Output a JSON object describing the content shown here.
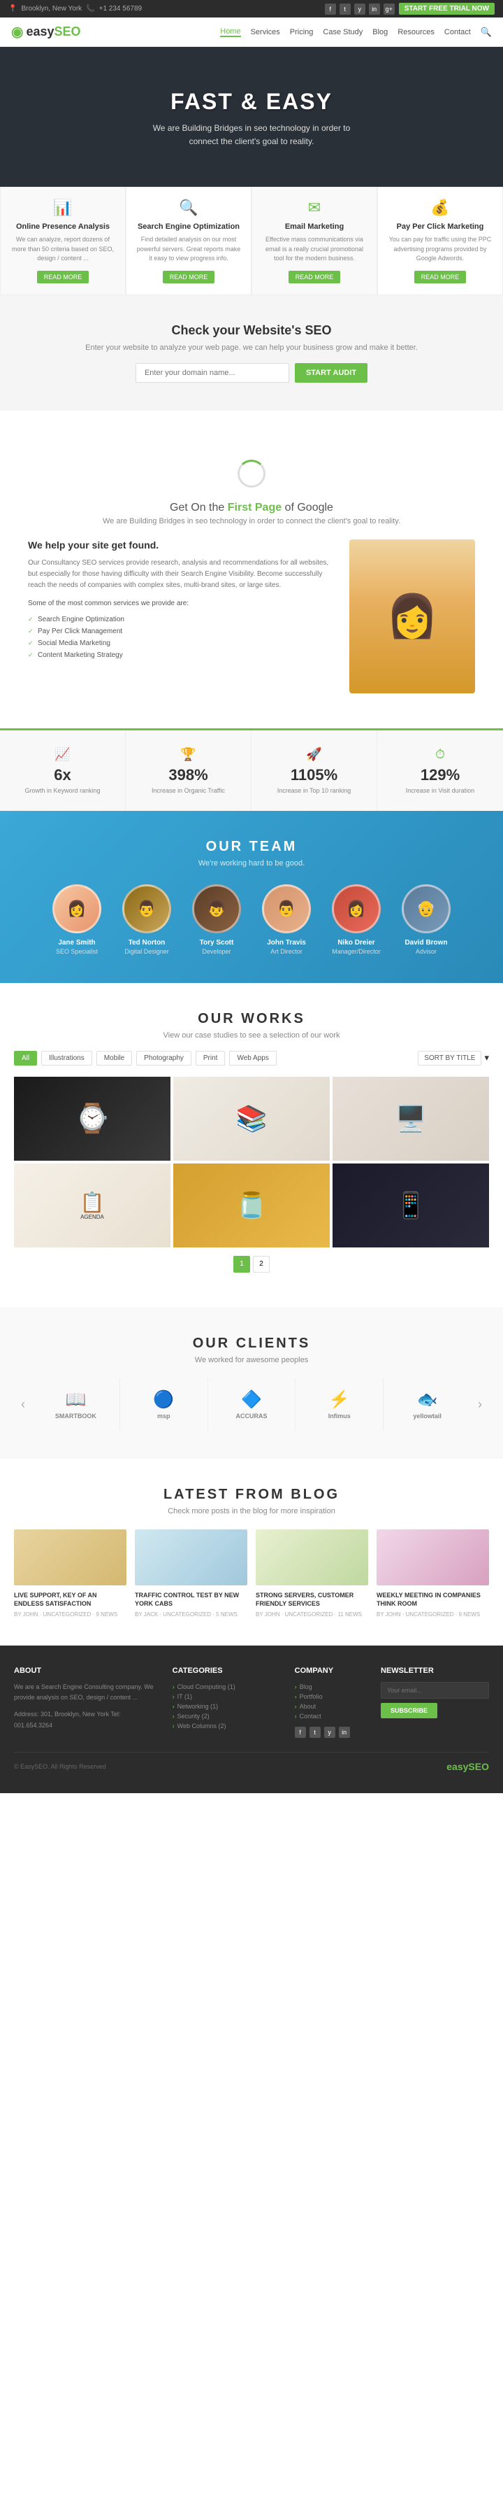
{
  "topbar": {
    "location": "Brooklyn, New York",
    "phone": "+1 234 56789",
    "social": [
      "f",
      "t",
      "y",
      "in",
      "g+"
    ],
    "cta": "START FREE TRIAL NOW"
  },
  "navbar": {
    "logo": "easy",
    "logo_suffix": "SEO",
    "links": [
      "Home",
      "Services",
      "Pricing",
      "Case Study",
      "Blog",
      "Resources",
      "Contact"
    ],
    "active": "Home"
  },
  "hero": {
    "title": "FAST & EASY",
    "description": "We are Building Bridges in seo technology in order to connect the client's goal to reality."
  },
  "services": [
    {
      "icon": "📊",
      "title": "Online Presence Analysis",
      "desc": "We can analyze, report dozens of more than 50 criteria based on SEO, design / content ...",
      "btn": "READ MORE"
    },
    {
      "icon": "🔍",
      "title": "Search Engine Optimization",
      "desc": "Find detailed analysis on our most powerful servers. Great reports make it easy to view progress info.",
      "btn": "READ MORE"
    },
    {
      "icon": "✉",
      "title": "Email Marketing",
      "desc": "Effective mass communications via email is a really crucial promotional tool for the modern business.",
      "btn": "READ MORE"
    },
    {
      "icon": "💰",
      "title": "Pay Per Click Marketing",
      "desc": "You can pay for traffic using the PPC advertising programs provided by Google Adwords.",
      "btn": "READ MORE"
    }
  ],
  "seo_check": {
    "title": "Check your Website's SEO",
    "desc": "Enter your website to analyze your web page. we can help your business grow and make it better.",
    "placeholder": "Enter your domain name...",
    "btn": "START AUDIT"
  },
  "google_section": {
    "pre_title": "Get On the",
    "title_bold": "First Page",
    "title_rest": "of Google",
    "sub": "We are Building Bridges in seo technology in order to connect the client's goal to reality.",
    "help_title": "We help your site get found.",
    "help_desc": "Our Consultancy SEO services provide research, analysis and recommendations for all websites, but especially for those having difficulty with their Search Engine Visibility. Become successfully reach the needs of companies with complex sites, multi-brand sites, or large sites.",
    "services_label": "Some of the most common services we provide are:",
    "services_list": [
      "Search Engine Optimization",
      "Pay Per Click Management",
      "Social Media Marketing",
      "Content Marketing Strategy"
    ]
  },
  "stats": [
    {
      "icon": "📈",
      "number": "6x",
      "label": "Growth in\nKeyword ranking"
    },
    {
      "icon": "🏆",
      "number": "398%",
      "label": "Increase in\nOrganic Traffic"
    },
    {
      "icon": "🚀",
      "number": "1105%",
      "label": "Increase in\nTop 10 ranking"
    },
    {
      "icon": "⏱",
      "number": "129%",
      "label": "Increase in\nVisit duration"
    }
  ],
  "team": {
    "title": "OUR TEAM",
    "subtitle": "We're working hard to be good.",
    "members": [
      {
        "name": "Jane Smith",
        "role": "SEO Specialist",
        "av": "av1"
      },
      {
        "name": "Ted Norton",
        "role": "Digital Designer",
        "av": "av2"
      },
      {
        "name": "Tory Scott",
        "role": "Developer",
        "av": "av3"
      },
      {
        "name": "John Travis",
        "role": "Art Director",
        "av": "av4"
      },
      {
        "name": "Niko Dreier",
        "role": "Manager/Director",
        "av": "av5"
      },
      {
        "name": "David Brown",
        "role": "Advisor",
        "av": "av6"
      }
    ]
  },
  "works": {
    "title": "OUR WORKS",
    "subtitle": "View our case studies to see a selection of our work",
    "filters": [
      "All",
      "Illustrations",
      "Mobile",
      "Photography",
      "Print",
      "Web Apps"
    ],
    "sort_label": "SORT BY TITLE",
    "items": [
      {
        "label": "Smart Watch",
        "style": "work-p1"
      },
      {
        "label": "Book Collection",
        "style": "work-p2"
      },
      {
        "label": "Desktop Setup",
        "style": "work-p3"
      },
      {
        "label": "Business Kit",
        "style": "work-p4"
      },
      {
        "label": "Honey Products",
        "style": "work-p5"
      },
      {
        "label": "Tablet Dark",
        "style": "work-p6"
      }
    ],
    "page_current": "1",
    "page_total": "2"
  },
  "clients": {
    "title": "OUR CLIENTS",
    "subtitle": "We worked for awesome peoples",
    "logos": [
      "SMARTBOOK",
      "msp",
      "ACCURAS",
      "Infimus",
      "yellowtail"
    ]
  },
  "blog": {
    "title": "LATEST FROM BLOG",
    "subtitle": "Check more posts in the blog for more inspiration",
    "posts": [
      {
        "title": "LIVE SUPPORT, KEY OF AN ENDLESS SATISFACTION",
        "meta": "BY JOHN · UNCATEGORIZED · 9 NEWS",
        "style": "blog-img-p1"
      },
      {
        "title": "TRAFFIC CONTROL TEST BY NEW YORK CABS",
        "meta": "BY JACK · UNCATEGORIZED · 5 NEWS",
        "style": "blog-img-p2"
      },
      {
        "title": "STRONG SERVERS, CUSTOMER FRIENDLY SERVICES",
        "meta": "BY JOHN · UNCATEGORIZED · 11 NEWS",
        "style": "blog-img-p3"
      },
      {
        "title": "WEEKLY MEETING IN COMPANIES THINK ROOM",
        "meta": "BY JOHN · UNCATEGORIZED · 9 NEWS",
        "style": "blog-img-p4"
      }
    ]
  },
  "footer": {
    "about_title": "ABOUT",
    "about_text": "We are a Search Engine Consulting company. We provide analysis on SEO, design / content ...",
    "address": "Address: 301, Brooklyn, New York\nTel: 001.654.3264",
    "categories_title": "CATEGORIES",
    "categories": [
      "Cloud Computing (1)",
      "IT (1)",
      "Networking (1)",
      "Security (2)",
      "Web Columns (2)"
    ],
    "company_title": "COMPANY",
    "company_links": [
      "Blog",
      "Portfolio",
      "About",
      "Contact"
    ],
    "newsletter_title": "NEWSLETTER",
    "newsletter_placeholder": "Your email...",
    "newsletter_btn": "SUBSCRIBE",
    "social": [
      "f",
      "t",
      "y",
      "in"
    ],
    "copyright": "© EasySEO. All Rights Reserved",
    "logo": "easy",
    "logo_suffix": "SEO"
  }
}
